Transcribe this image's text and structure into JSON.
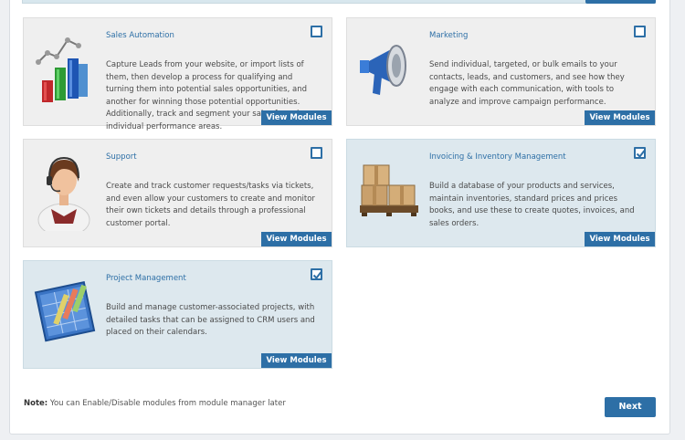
{
  "modules": [
    {
      "title": "Sales Automation",
      "description": "Capture Leads from your website, or import lists of them, then develop a process for qualifying and turning them into potential sales opportunities, and another for winning those potential opportunities. Additionally, track and segment your sales funnel, individual performance areas.",
      "checked": false,
      "icon": "bar-chart-icon",
      "button": "View Modules"
    },
    {
      "title": "Marketing",
      "description": "Send individual, targeted, or bulk emails to your contacts, leads, and customers, and see how they engage with each communication, with tools to analyze and improve campaign performance.",
      "checked": false,
      "icon": "megaphone-icon",
      "button": "View Modules"
    },
    {
      "title": "Support",
      "description": "Create and track customer requests/tasks via tickets, and even allow your customers to create and monitor their own tickets and details through a professional customer portal.",
      "checked": false,
      "icon": "support-agent-icon",
      "button": "View Modules"
    },
    {
      "title": "Invoicing & Inventory Management",
      "description": "Build a database of your products and services, maintain inventories, standard prices and prices books, and use these to create quotes, invoices, and sales orders.",
      "checked": true,
      "icon": "boxes-icon",
      "button": "View Modules"
    },
    {
      "title": "Project Management",
      "description": "Build and manage customer-associated projects, with detailed tasks that can be assigned to CRM users and placed on their calendars.",
      "checked": true,
      "icon": "gantt-chart-icon",
      "button": "View Modules"
    }
  ],
  "footer": {
    "note_label": "Note:",
    "note_text": " You can Enable/Disable modules from module manager later",
    "next_label": "Next"
  },
  "colors": {
    "accent": "#2d6fa6",
    "card_bg": "#efefef",
    "card_selected_bg": "#dde8ee"
  }
}
